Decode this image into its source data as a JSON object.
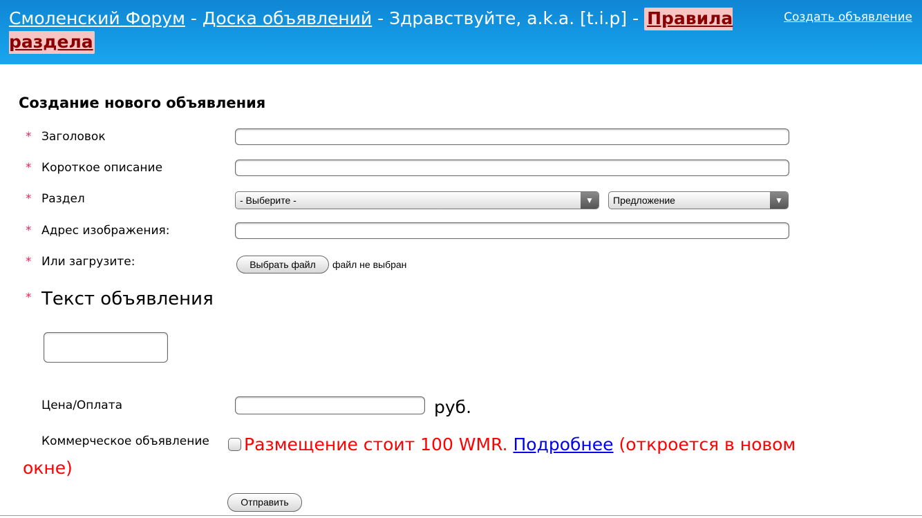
{
  "header": {
    "forum_link": "Смоленский Форум",
    "sep1": " - ",
    "board_link": "Доска объявлений",
    "greeting": " - Здравствуйте, a.k.a. [t.i.p] - ",
    "rules_link": "Правила раздела",
    "create_link": "Создать объявление"
  },
  "form": {
    "heading": "Создание нового объявления",
    "required_mark": "*",
    "title_label": "Заголовок",
    "short_desc_label": "Короткое описание",
    "section_label": "Раздел",
    "section_select_value": "- Выберите -",
    "type_select_value": "Предложение",
    "image_url_label": "Адрес изображения:",
    "upload_label": "Или загрузите:",
    "file_button": "Выбрать файл",
    "file_status": "файл не выбран",
    "text_label": "Текст объявления",
    "price_label": "Цена/Оплата",
    "price_unit": "руб.",
    "commercial_label": "Коммерческое объявление",
    "commercial_note_start": "Размещение стоит 100 WMR. ",
    "commercial_note_link": "Подробнее",
    "commercial_note_end": " (откроется в новом окне)",
    "submit_button": "Отправить"
  }
}
